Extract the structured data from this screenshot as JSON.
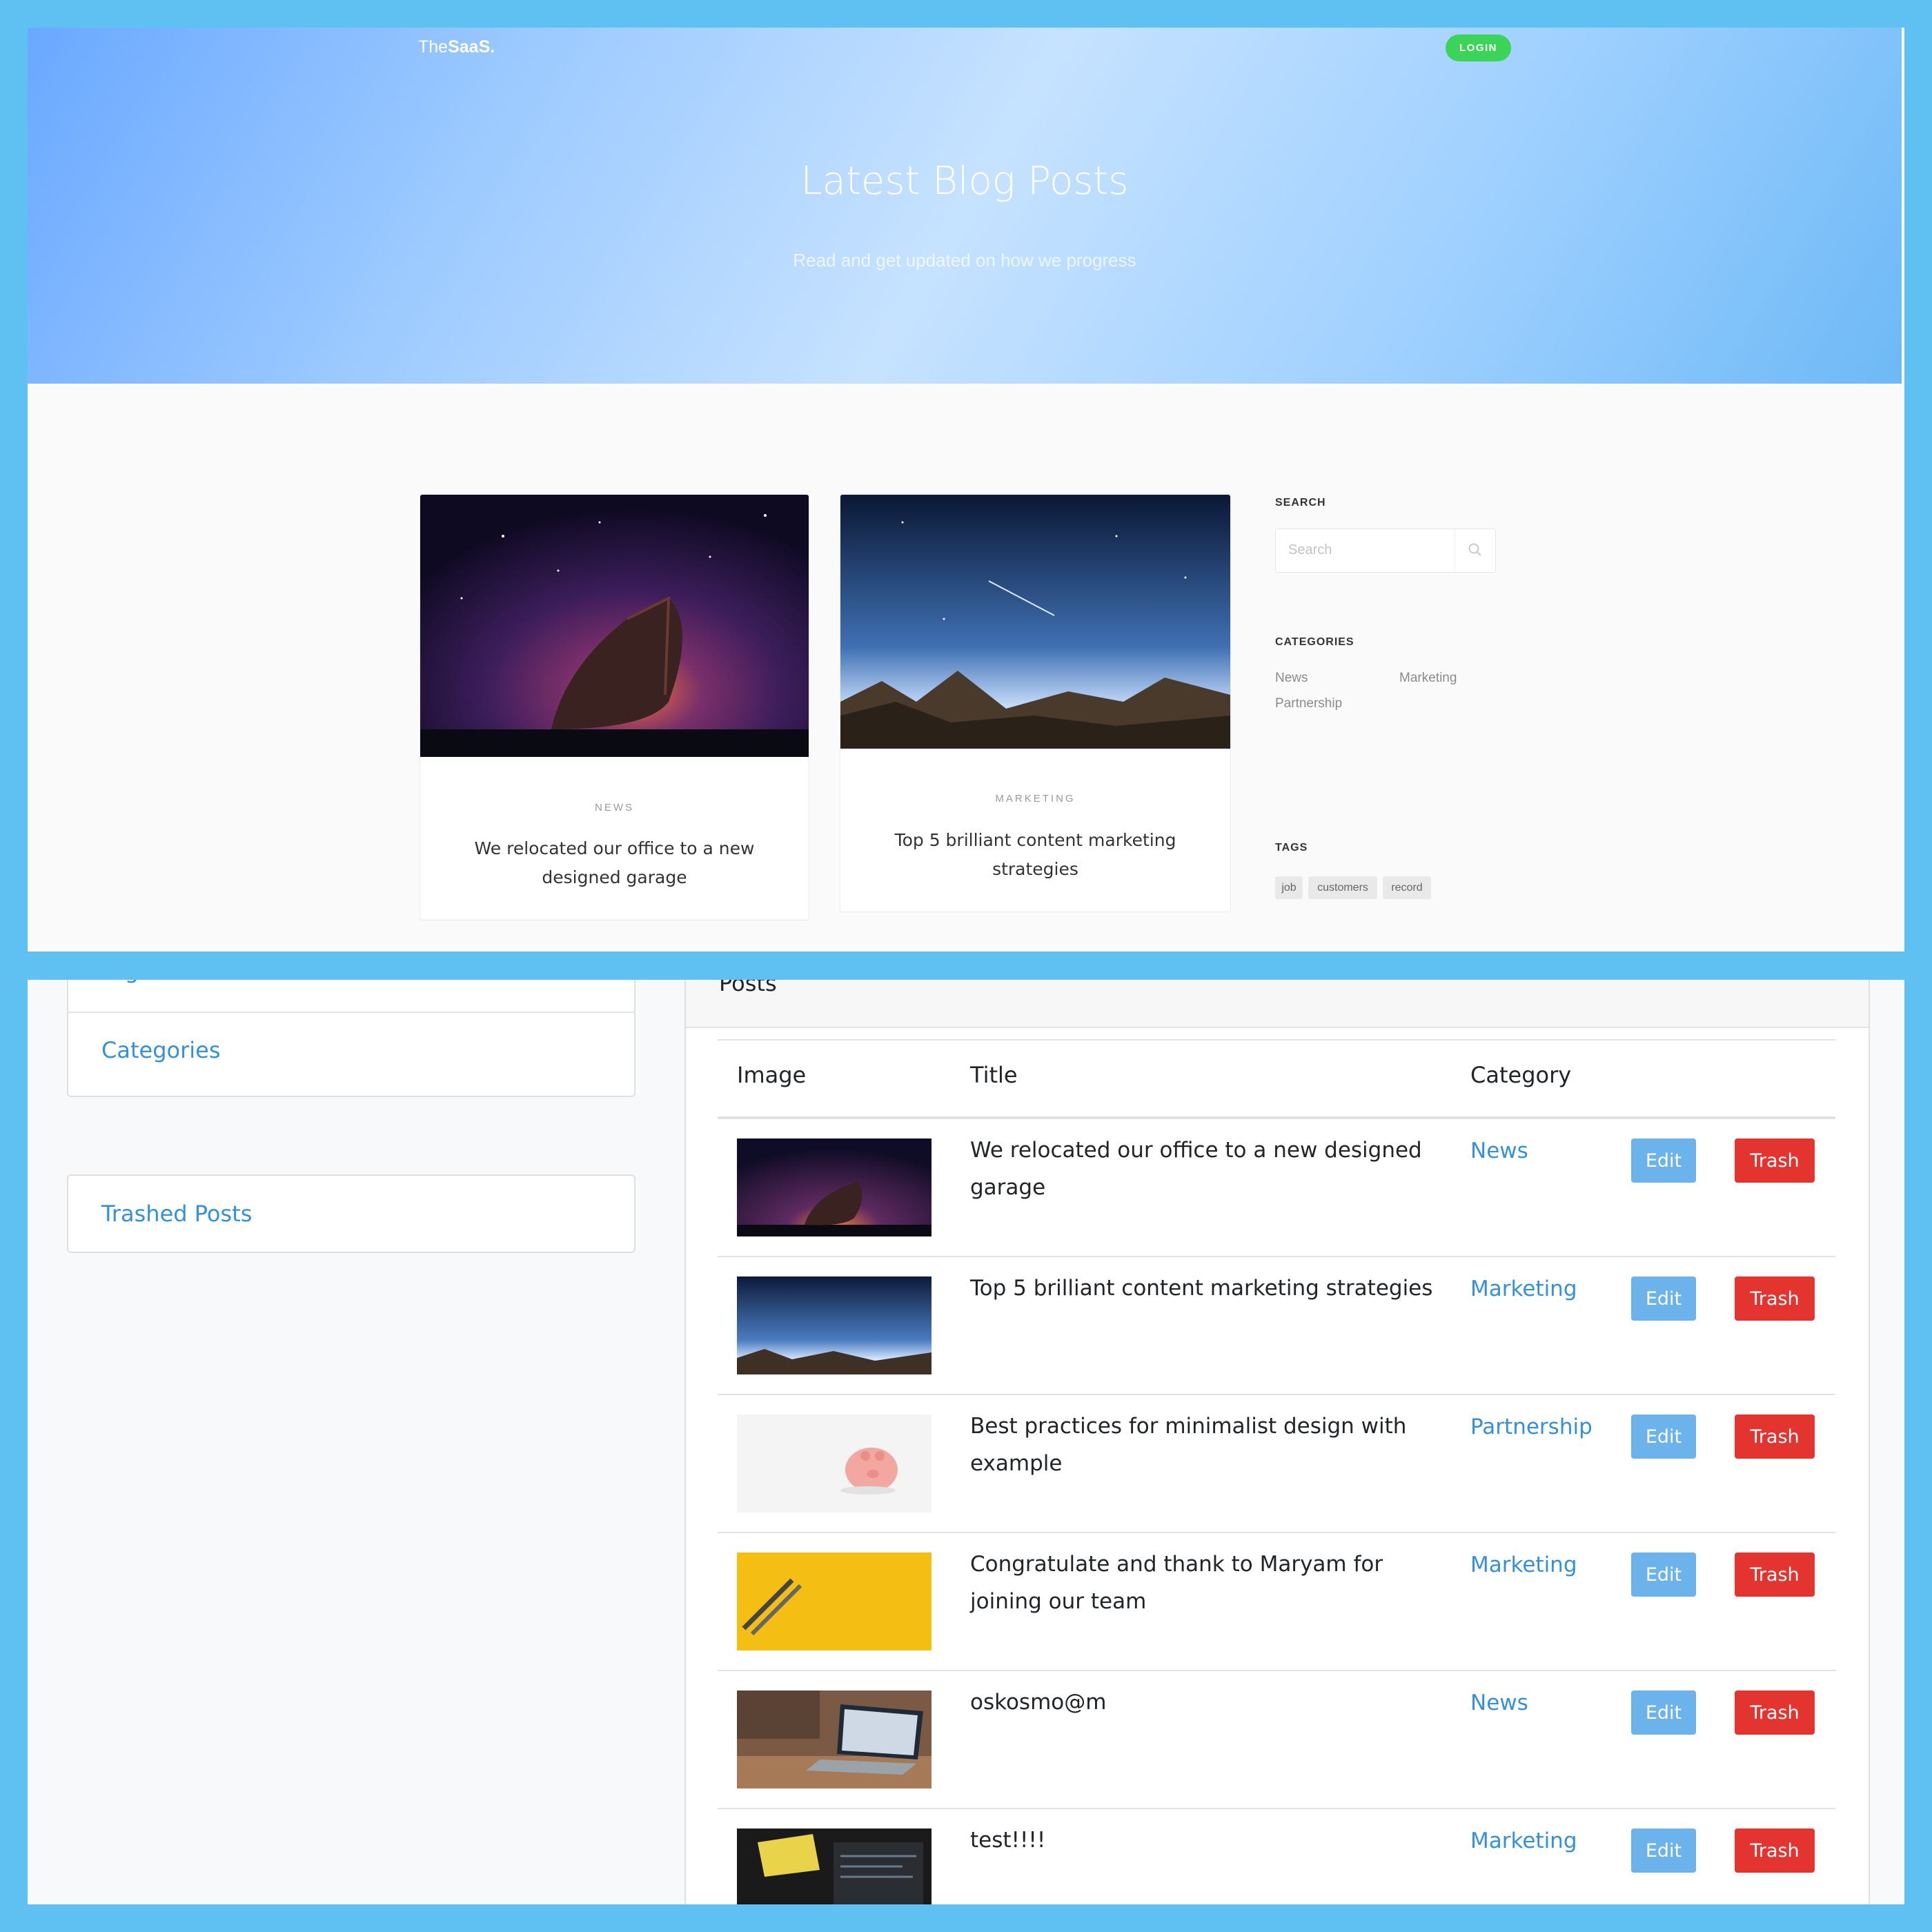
{
  "blog": {
    "brand_prefix": "The",
    "brand_bold": "SaaS.",
    "login_label": "LOGIN",
    "hero_title": "Latest Blog Posts",
    "hero_subtitle": "Read and get updated on how we progress",
    "cards": [
      {
        "category": "NEWS",
        "title": "We relocated our office to a new designed garage"
      },
      {
        "category": "MARKETING",
        "title": "Top 5 brilliant content marketing strategies"
      }
    ],
    "sidebar": {
      "search_heading": "SEARCH",
      "search_placeholder": "Search",
      "categories_heading": "CATEGORIES",
      "categories": [
        "News",
        "Marketing",
        "Partnership"
      ],
      "tags_heading": "TAGS",
      "tags": [
        "job",
        "customers",
        "record"
      ]
    }
  },
  "admin": {
    "nav": {
      "tags_label": "Tags",
      "categories_label": "Categories",
      "trashed_label": "Trashed Posts"
    },
    "posts_header": "Posts",
    "columns": [
      "Image",
      "Title",
      "Category"
    ],
    "edit_label": "Edit",
    "trash_label": "Trash",
    "rows": [
      {
        "title": "We relocated our office to a new designed garage",
        "category": "News",
        "image": "boat-night-sky"
      },
      {
        "title": "Top 5 brilliant content marketing strategies",
        "category": "Marketing",
        "image": "mountain-starry-sky"
      },
      {
        "title": "Best practices for minimalist design with example",
        "category": "Partnership",
        "image": "piggy-bank"
      },
      {
        "title": "Congratulate and thank to Maryam for joining our team",
        "category": "Marketing",
        "image": "pencils-yellow"
      },
      {
        "title": "oskosmo@m",
        "category": "News",
        "image": "laptop-desk"
      },
      {
        "title": "test!!!!",
        "category": "Marketing",
        "image": "dark-screen"
      }
    ]
  },
  "colors": {
    "frame": "#5ec1f1",
    "login_green": "#3cd458",
    "link_blue": "#3490dc",
    "edit_blue": "#6cb2eb",
    "trash_red": "#e3342f"
  }
}
